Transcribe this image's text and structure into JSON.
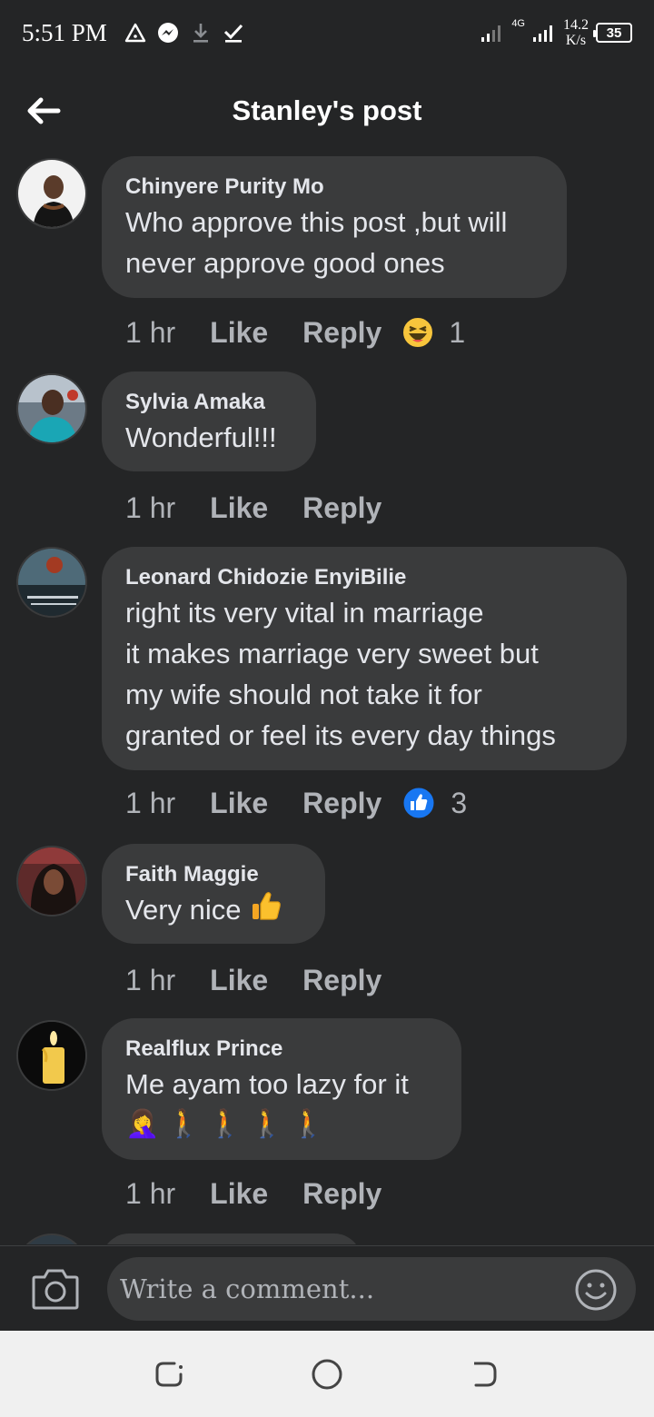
{
  "status_bar": {
    "time": "5:51 PM",
    "network": "4G",
    "speed_value": "14.2",
    "speed_unit": "K/s",
    "battery": "35"
  },
  "header": {
    "title": "Stanley's post"
  },
  "comments": [
    {
      "name": "Chinyere Purity Mo",
      "text": "Who approve this post ,but will\nnever approve good ones",
      "time": "1 hr",
      "like": "Like",
      "reply": "Reply",
      "reaction_icon": "laughing-emoji",
      "reaction_count": "1"
    },
    {
      "name": "Sylvia Amaka",
      "text": "Wonderful!!!",
      "time": "1 hr",
      "like": "Like",
      "reply": "Reply"
    },
    {
      "name": "Leonard Chidozie EnyiBilie",
      "text": "right its very vital in marriage\nit makes marriage very sweet but\nmy wife should not take it for\ngranted or feel its every day things",
      "time": "1 hr",
      "like": "Like",
      "reply": "Reply",
      "reaction_icon": "like-reaction",
      "reaction_count": "3"
    },
    {
      "name": "Faith Maggie",
      "text": "Very nice",
      "emoji": "👍",
      "time": "1 hr",
      "like": "Like",
      "reply": "Reply"
    },
    {
      "name": "Realflux Prince",
      "text": "Me ayam too lazy for it",
      "emoji_line": "🤦‍♀️ 🚶 🚶 🚶 🚶",
      "time": "1 hr",
      "like": "Like",
      "reply": "Reply"
    }
  ],
  "composer": {
    "placeholder": "Write a comment..."
  },
  "colors": {
    "background": "#242526",
    "bubble": "#3a3b3c",
    "text": "#e4e6eb",
    "secondary": "#b0b3b8",
    "like_blue": "#1877f2",
    "navbar": "#f0f0f0"
  }
}
